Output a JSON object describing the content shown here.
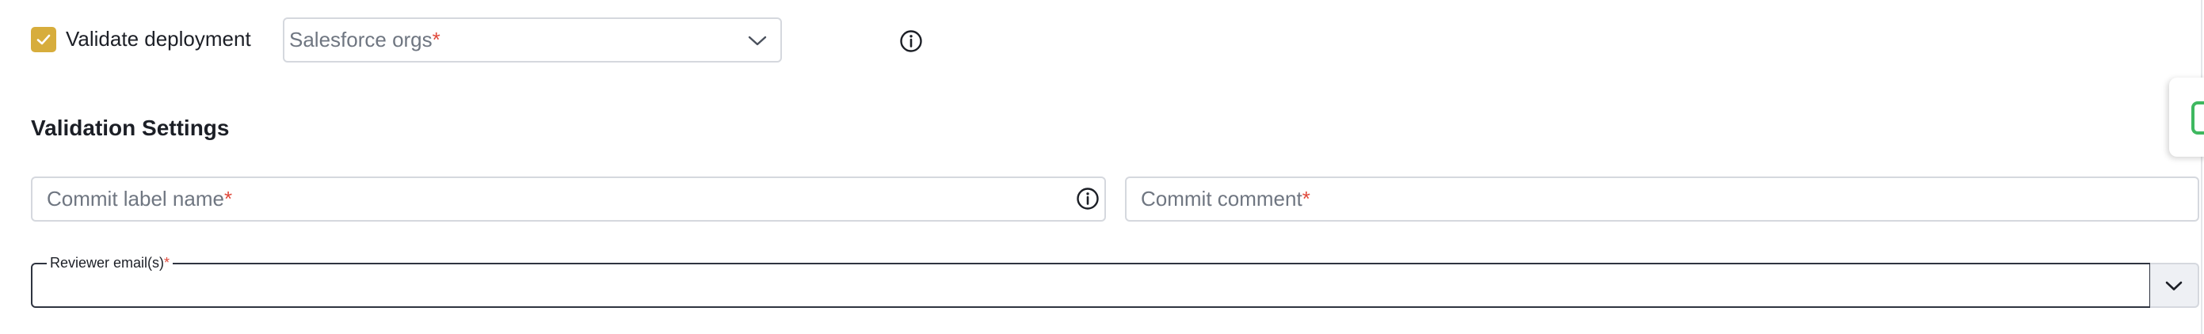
{
  "validate": {
    "label": "Validate deployment",
    "checked": true,
    "check_color": "#d7ad3c"
  },
  "orgs": {
    "placeholder": "Salesforce orgs",
    "required_mark": "*"
  },
  "section": {
    "title": "Validation Settings"
  },
  "commit_label": {
    "placeholder": "Commit label name",
    "required_mark": "*"
  },
  "commit_comment": {
    "placeholder": "Commit comment",
    "required_mark": "*"
  },
  "reviewers": {
    "legend": "Reviewer email(s)",
    "required_mark": "*",
    "value": ""
  },
  "colors": {
    "required": "#e0483a",
    "accent_green": "#3fb860"
  },
  "icons": {
    "check": "check-icon",
    "chevron": "chevron-down-icon",
    "info": "info-icon"
  }
}
